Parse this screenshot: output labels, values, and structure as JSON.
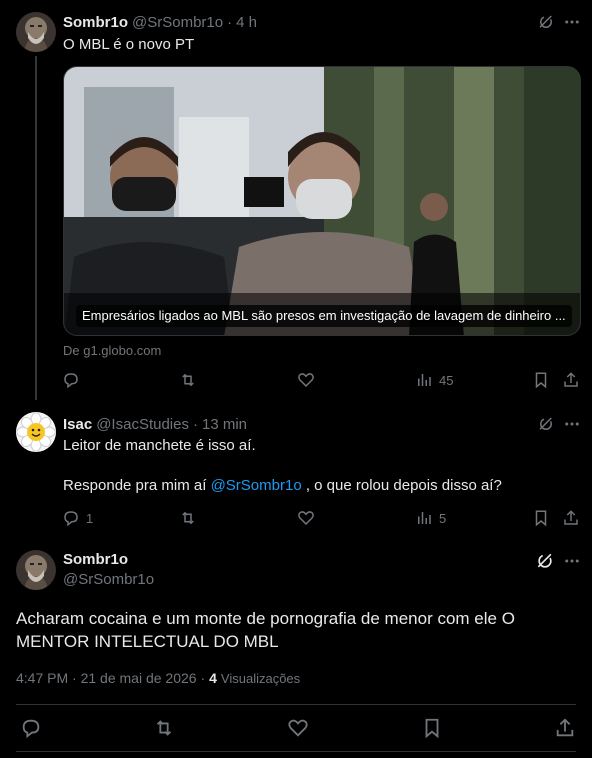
{
  "tweet1": {
    "name": "Sombr1o",
    "handle": "@SrSombr1o",
    "sep": "·",
    "time": "4 h",
    "text": "O MBL é o novo PT",
    "card": {
      "headline": "Empresários ligados ao MBL são presos em investigação de lavagem de dinheiro ...",
      "source": "De g1.globo.com"
    },
    "views": "45"
  },
  "tweet2": {
    "name": "Isac",
    "handle": "@IsacStudies",
    "sep": "·",
    "time": "13 min",
    "line1": "Leitor de manchete é isso aí.",
    "line2_pre": "Responde pra mim aí ",
    "line2_mention": "@SrSombr1o",
    "line2_post": " , o que rolou depois disso aí?",
    "replies": "1",
    "views": "5"
  },
  "tweet3": {
    "name": "Sombr1o",
    "handle": "@SrSombr1o",
    "text_line1": "Acharam cocaina e um monte de pornografia de menor com ele O",
    "text_line2": "MENTOR INTELECTUAL DO MBL",
    "timestamp": "4:47 PM · 21 de mai de 2026 ·",
    "views_count": "4",
    "views_label": "Visualizações"
  },
  "icons": {
    "reply": "reply-icon",
    "retweet": "retweet-icon",
    "like": "like-icon",
    "views": "views-icon",
    "bookmark": "bookmark-icon",
    "share": "share-icon",
    "grok": "grok-icon",
    "more": "more-icon"
  },
  "colors": {
    "background": "#000000",
    "text": "#e7e9ea",
    "muted": "#71767b",
    "link": "#1d9bf0",
    "divider": "#2f3336"
  }
}
